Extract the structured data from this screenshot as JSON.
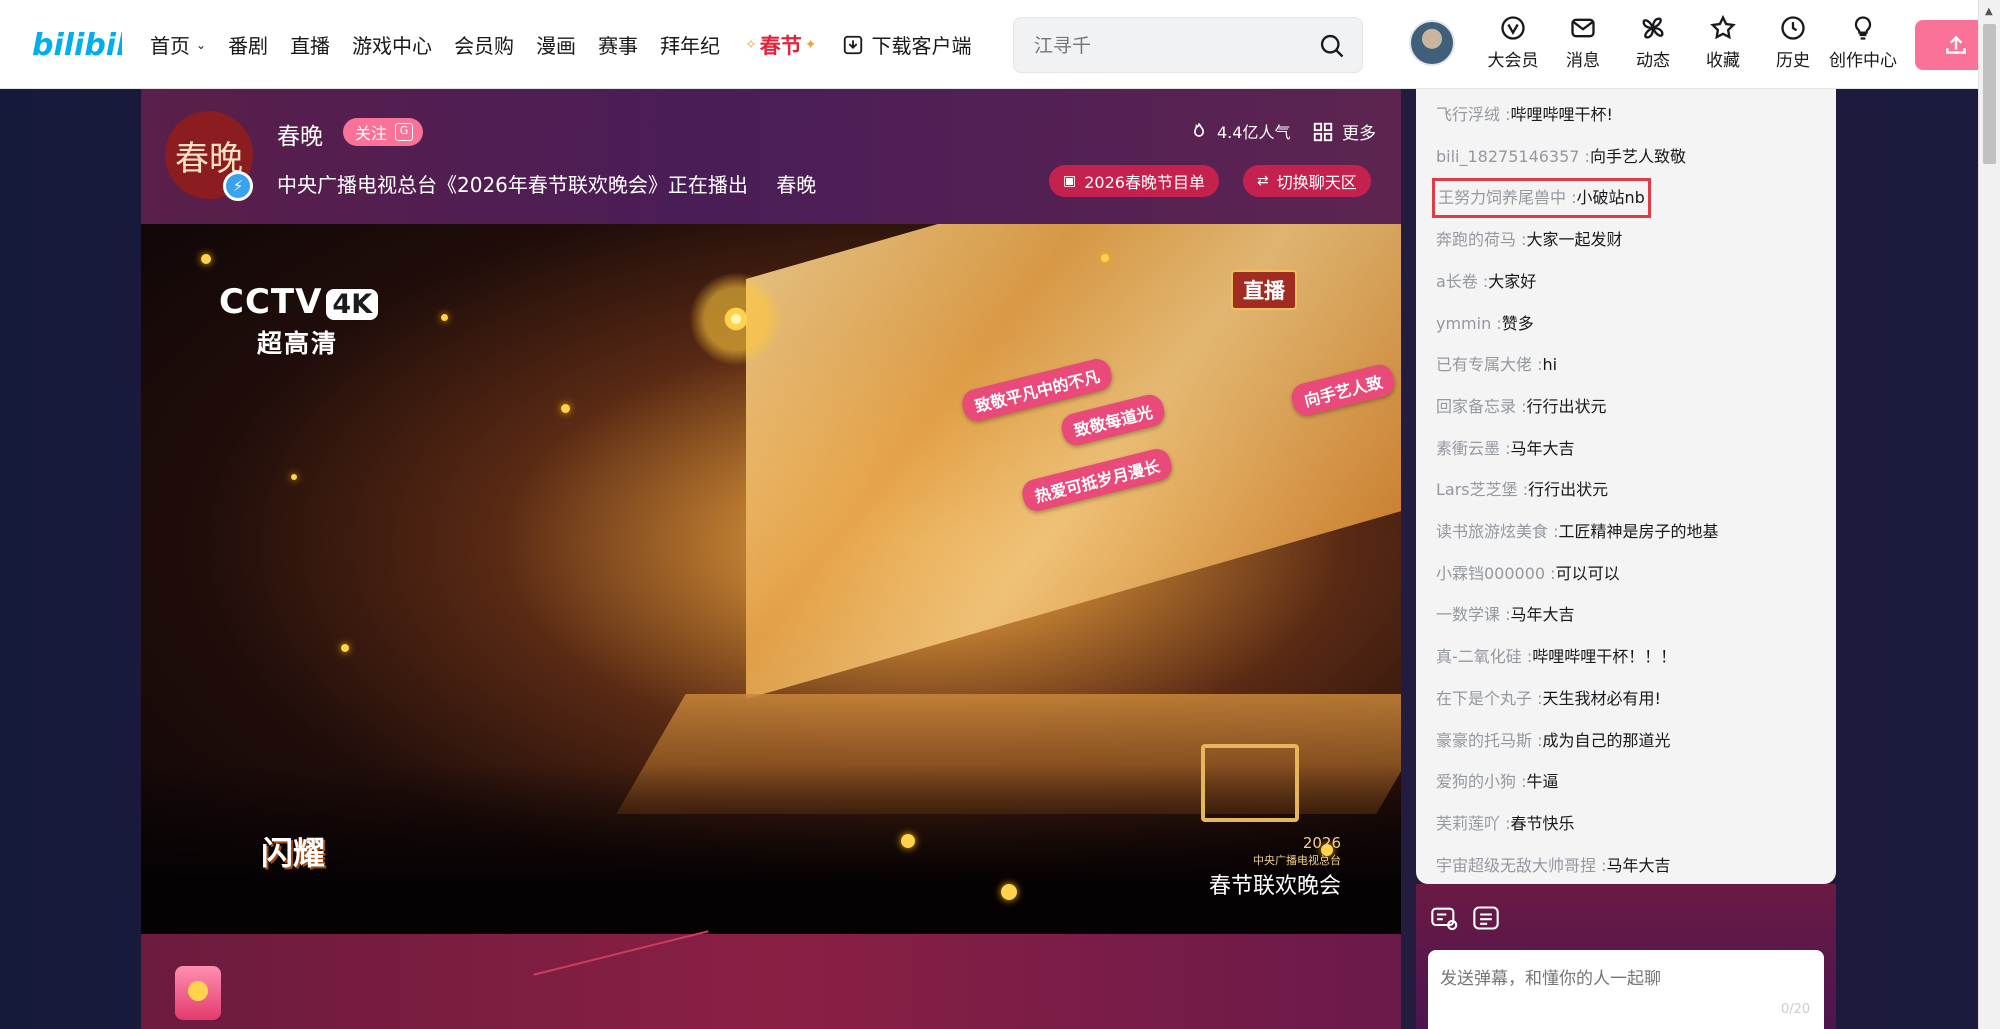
{
  "nav": {
    "logo_text": "bilibili",
    "items": [
      {
        "label": "首页",
        "has_dropdown": true
      },
      {
        "label": "番剧"
      },
      {
        "label": "直播"
      },
      {
        "label": "游戏中心"
      },
      {
        "label": "会员购"
      },
      {
        "label": "漫画"
      },
      {
        "label": "赛事"
      },
      {
        "label": "拜年纪"
      }
    ],
    "spring_label": "春节",
    "download_label": "下载客户端",
    "search": {
      "placeholder": "江寻千",
      "icon": "search-icon"
    },
    "right_entries": [
      {
        "label": "大会员",
        "icon": "vip-icon"
      },
      {
        "label": "消息",
        "icon": "mail-icon"
      },
      {
        "label": "动态",
        "icon": "pinwheel-icon"
      },
      {
        "label": "收藏",
        "icon": "star-icon"
      },
      {
        "label": "历史",
        "icon": "clock-icon"
      },
      {
        "label": "创作中心",
        "icon": "bulb-icon"
      }
    ],
    "upload_icon": "upload-icon",
    "colors": {
      "brand": "#00aeec",
      "upload": "#fb7299",
      "spring": "#e0243b"
    }
  },
  "room": {
    "host_avatar_text": "春晚",
    "host_name": "春晚",
    "follow_label": "关注",
    "follow_badge": "G",
    "title": "中央广播电视总台《2026年春节联欢晚会》正在播出",
    "area": "春晚",
    "popularity": "4.4亿人气",
    "more_label": "更多",
    "program_button": "2026春晚节目单",
    "switch_chat_button": "切换聊天区"
  },
  "video": {
    "channel_logo": "CCTV",
    "channel_4k": "4K",
    "channel_sub": "超高清",
    "live_badge": "直播",
    "song_title": "闪耀",
    "gala_year": "2026",
    "gala_org": "中央广播电视总台",
    "gala_name": "春节联欢晚会",
    "bullets": [
      "致敬平凡中的不凡",
      "致敬每道光",
      "热爱可抵岁月漫长",
      "向手艺人致"
    ]
  },
  "chat": {
    "messages": [
      {
        "user": "飞行浮绒",
        "text": "哔哩哔哩干杯!"
      },
      {
        "user": "bili_18275146357",
        "text": "向手艺人致敬"
      },
      {
        "user": "王努力饲养尾兽中",
        "text": "小破站nb",
        "highlighted": true
      },
      {
        "user": "奔跑的荷马",
        "text": "大家一起发财"
      },
      {
        "user": "a长卷",
        "text": "大家好"
      },
      {
        "user": "ymmin",
        "text": "赞多"
      },
      {
        "user": "已有专属大佬",
        "text": "hi"
      },
      {
        "user": "回家备忘录",
        "text": "行行出状元"
      },
      {
        "user": "素衝云墨",
        "text": "马年大吉"
      },
      {
        "user": "Lars芝芝堡",
        "text": "行行出状元"
      },
      {
        "user": "读书旅游炫美食",
        "text": "工匠精神是房子的地基"
      },
      {
        "user": "小霖铛000000",
        "text": "可以可以"
      },
      {
        "user": "一数学课",
        "text": "马年大吉"
      },
      {
        "user": "真-二氧化硅",
        "text": "哔哩哔哩干杯！！！"
      },
      {
        "user": "在下是个丸子",
        "text": "天生我材必有用!"
      },
      {
        "user": "豪豪的托马斯",
        "text": "成为自己的那道光"
      },
      {
        "user": "爱狗的小狗",
        "text": "牛逼"
      },
      {
        "user": "芙莉莲吖",
        "text": "春节快乐"
      },
      {
        "user": "宇宙超级无敌大帅哥捏",
        "text": "马年大吉"
      }
    ],
    "input_placeholder": "发送弹幕，和懂你的人一起聊",
    "char_count": "0/20",
    "highlight_color": "#e03b46"
  }
}
